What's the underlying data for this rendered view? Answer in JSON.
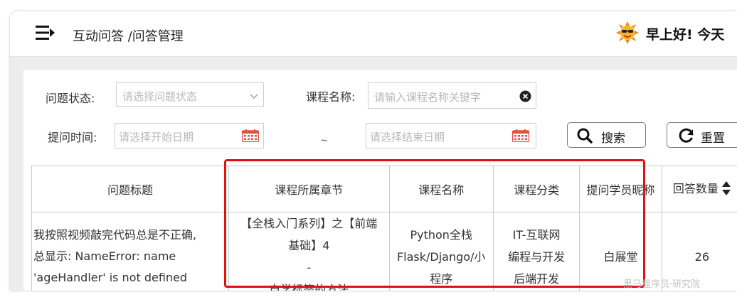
{
  "header": {
    "breadcrumb": "互动问答 /问答管理",
    "greeting": "早上好!  今天"
  },
  "filters": {
    "status_label": "问题状态:",
    "status_placeholder": "请选择问题状态",
    "course_label": "课程名称:",
    "course_placeholder": "请输入课程名称关键字",
    "time_label": "提问时间:",
    "start_placeholder": "请选择开始日期",
    "range_separator": "~",
    "end_placeholder": "请选择结束日期",
    "search_label": "搜索",
    "reset_label": "重置"
  },
  "table": {
    "columns": [
      "问题标题",
      "课程所属章节",
      "课程名称",
      "课程分类",
      "提问学员昵称",
      "回答数量"
    ],
    "rows": [
      {
        "title": [
          "我按照视频敲完代码总是不正确,",
          "总显示:  NameError: name",
          "'ageHandler' is not defined"
        ],
        "chapter": [
          "【全栈入门系列】之【前端",
          "基础】4",
          "-",
          "自学标签的方法"
        ],
        "course": [
          "Python全栈",
          "Flask/Django/小",
          "程序"
        ],
        "category": [
          "IT-互联网",
          "编程与开发",
          "后端开发"
        ],
        "student": "白展堂",
        "answers": "26"
      }
    ]
  },
  "watermark": "黑马程序员·研究院",
  "colors": {
    "highlight": "#e01010",
    "date_icon": "#e25040"
  }
}
